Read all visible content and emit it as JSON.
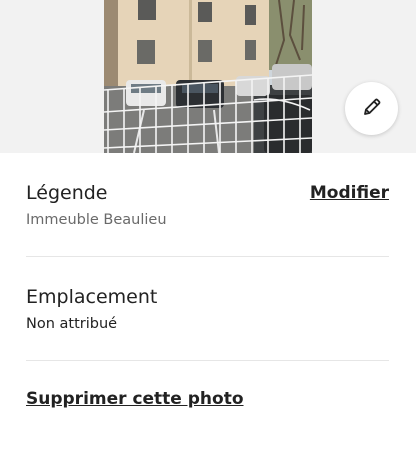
{
  "photo": {
    "edit_icon": "pencil-icon"
  },
  "caption_section": {
    "title": "Légende",
    "value": "Immeuble Beaulieu",
    "modify_label": "Modifier"
  },
  "location_section": {
    "title": "Emplacement",
    "value": "Non attribué"
  },
  "delete_label": "Supprimer cette photo",
  "colors": {
    "text": "#222222",
    "secondary_text": "#6a6a6a",
    "divider": "#e6e6e6",
    "photo_backdrop": "#f2f2f2"
  }
}
